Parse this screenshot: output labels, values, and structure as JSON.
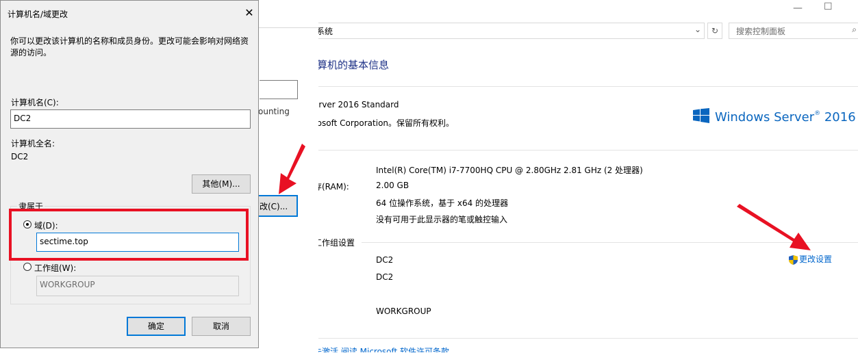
{
  "control_panel": {
    "address_text": "系统",
    "search_placeholder": "搜索控制面板",
    "heading": "算机的基本信息",
    "edition_line1": "erver 2016 Standard",
    "edition_line2": "rosoft Corporation。保留所有权利。",
    "logo_text": "Windows Server",
    "logo_sup": "®",
    "logo_year": " 2016",
    "processor": "Intel(R) Core(TM) i7-7700HQ CPU @ 2.80GHz   2.81 GHz  (2 处理器)",
    "ram_label": "存(RAM):",
    "ram": "2.00 GB",
    "system_type": "64 位操作系统，基于 x64 的处理器",
    "pen_touch": "没有可用于此显示器的笔或触控输入",
    "section_computer": "工作组设置",
    "computer_name": "DC2",
    "full_name": "DC2",
    "workgroup": "WORKGROUP",
    "change_settings": "更改设置",
    "bottom_partial": "未激活   阅读 Microsoft 软件许可条款",
    "colors": {
      "link": "#0066cc",
      "heading": "#1e3287",
      "accent": "#0078d7",
      "highlight": "#e81123"
    }
  },
  "middle_window": {
    "account_partial": "ounting",
    "change_button": "改(C)..."
  },
  "dialog": {
    "title": "计算机名/域更改",
    "close_icon": "close-icon",
    "description": "你可以更改该计算机的名称和成员身份。更改可能会影响对网络资源的访问。",
    "name_label": "计算机名(C):",
    "name_value": "DC2",
    "fullname_label": "计算机全名:",
    "fullname_value": "DC2",
    "more_button": "其他(M)...",
    "member_of": "隶属于",
    "domain_label": "域(D):",
    "domain_value": "sectime.top",
    "workgroup_label": "工作组(W):",
    "workgroup_value": "WORKGROUP",
    "ok_button": "确定",
    "cancel_button": "取消",
    "selected_option": "domain"
  }
}
